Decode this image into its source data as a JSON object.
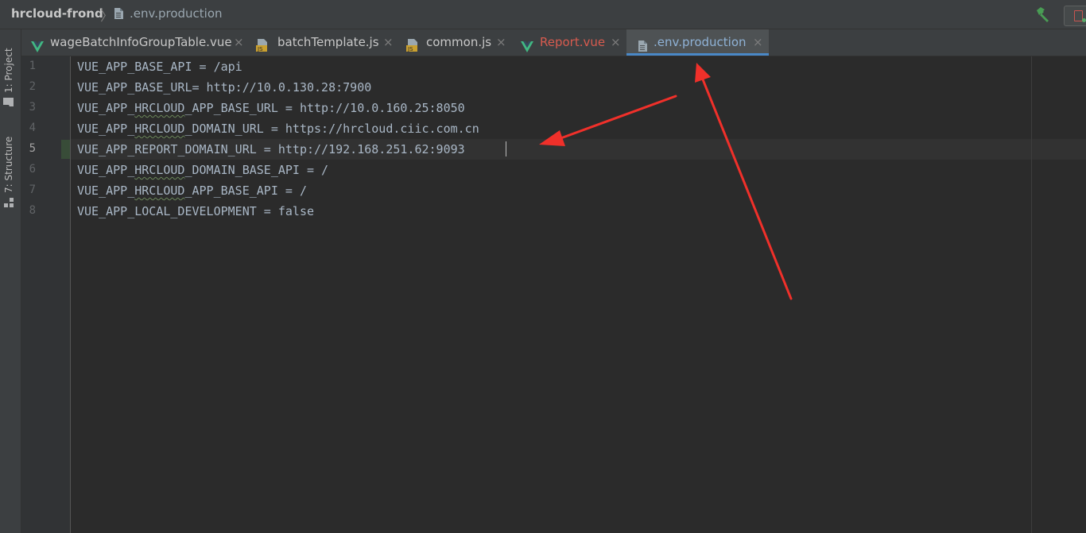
{
  "navbar": {
    "project": "hrcloud-frond",
    "file": ".env.production"
  },
  "tool_stripe": {
    "project_label": "1: Project",
    "structure_label": "7: Structure"
  },
  "tabs": [
    {
      "label": "wageBatchInfoGroupTable.vue",
      "icon": "vue-icon"
    },
    {
      "label": "batchTemplate.js",
      "icon": "js-file-icon"
    },
    {
      "label": "common.js",
      "icon": "js-file-icon"
    },
    {
      "label": "Report.vue",
      "icon": "vue-icon"
    },
    {
      "label": ".env.production",
      "icon": "text-file-icon",
      "active": true
    }
  ],
  "tab_close_glyph": "×",
  "editor": {
    "current_line": 5,
    "line_numbers": [
      "1",
      "2",
      "3",
      "4",
      "5",
      "6",
      "7",
      "8"
    ],
    "lines": [
      {
        "pre": "VUE_APP_BASE_API = /api",
        "sq": "",
        "post": ""
      },
      {
        "pre": "VUE_APP_BASE_URL= http://10.0.130.28:7900",
        "sq": "",
        "post": ""
      },
      {
        "pre": "VUE_APP_",
        "sq": "HRCLOUD",
        "post": "_APP_BASE_URL = http://10.0.160.25:8050"
      },
      {
        "pre": "VUE_APP_",
        "sq": "HRCLOUD",
        "post": "_DOMAIN_URL = https://hrcloud.ciic.com.cn"
      },
      {
        "pre": "VUE_APP_REPORT_DOMAIN_URL = http://192.168.251.62:9093",
        "sq": "",
        "post": ""
      },
      {
        "pre": "VUE_APP_",
        "sq": "HRCLOUD",
        "post": "_DOMAIN_BASE_API = /"
      },
      {
        "pre": "VUE_APP_",
        "sq": "HRCLOUD",
        "post": "_APP_BASE_API = /"
      },
      {
        "pre": "VUE_APP_LOCAL_DEVELOPMENT = false",
        "sq": "",
        "post": ""
      }
    ]
  },
  "colors": {
    "annotation_arrow": "#f0302a",
    "vue_green": "#41b883",
    "active_tab_underline": "#4a88c7"
  }
}
